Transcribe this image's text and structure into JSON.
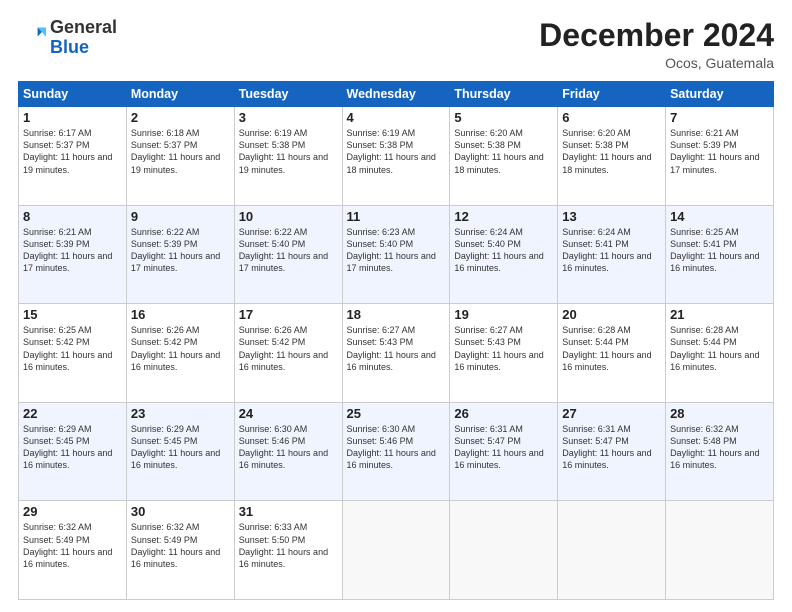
{
  "header": {
    "logo_line1": "General",
    "logo_line2": "Blue",
    "month_title": "December 2024",
    "location": "Ocos, Guatemala"
  },
  "days_of_week": [
    "Sunday",
    "Monday",
    "Tuesday",
    "Wednesday",
    "Thursday",
    "Friday",
    "Saturday"
  ],
  "weeks": [
    [
      {
        "day": "1",
        "sunrise": "6:17 AM",
        "sunset": "5:37 PM",
        "daylight": "11 hours and 19 minutes."
      },
      {
        "day": "2",
        "sunrise": "6:18 AM",
        "sunset": "5:37 PM",
        "daylight": "11 hours and 19 minutes."
      },
      {
        "day": "3",
        "sunrise": "6:19 AM",
        "sunset": "5:38 PM",
        "daylight": "11 hours and 19 minutes."
      },
      {
        "day": "4",
        "sunrise": "6:19 AM",
        "sunset": "5:38 PM",
        "daylight": "11 hours and 18 minutes."
      },
      {
        "day": "5",
        "sunrise": "6:20 AM",
        "sunset": "5:38 PM",
        "daylight": "11 hours and 18 minutes."
      },
      {
        "day": "6",
        "sunrise": "6:20 AM",
        "sunset": "5:38 PM",
        "daylight": "11 hours and 18 minutes."
      },
      {
        "day": "7",
        "sunrise": "6:21 AM",
        "sunset": "5:39 PM",
        "daylight": "11 hours and 17 minutes."
      }
    ],
    [
      {
        "day": "8",
        "sunrise": "6:21 AM",
        "sunset": "5:39 PM",
        "daylight": "11 hours and 17 minutes."
      },
      {
        "day": "9",
        "sunrise": "6:22 AM",
        "sunset": "5:39 PM",
        "daylight": "11 hours and 17 minutes."
      },
      {
        "day": "10",
        "sunrise": "6:22 AM",
        "sunset": "5:40 PM",
        "daylight": "11 hours and 17 minutes."
      },
      {
        "day": "11",
        "sunrise": "6:23 AM",
        "sunset": "5:40 PM",
        "daylight": "11 hours and 17 minutes."
      },
      {
        "day": "12",
        "sunrise": "6:24 AM",
        "sunset": "5:40 PM",
        "daylight": "11 hours and 16 minutes."
      },
      {
        "day": "13",
        "sunrise": "6:24 AM",
        "sunset": "5:41 PM",
        "daylight": "11 hours and 16 minutes."
      },
      {
        "day": "14",
        "sunrise": "6:25 AM",
        "sunset": "5:41 PM",
        "daylight": "11 hours and 16 minutes."
      }
    ],
    [
      {
        "day": "15",
        "sunrise": "6:25 AM",
        "sunset": "5:42 PM",
        "daylight": "11 hours and 16 minutes."
      },
      {
        "day": "16",
        "sunrise": "6:26 AM",
        "sunset": "5:42 PM",
        "daylight": "11 hours and 16 minutes."
      },
      {
        "day": "17",
        "sunrise": "6:26 AM",
        "sunset": "5:42 PM",
        "daylight": "11 hours and 16 minutes."
      },
      {
        "day": "18",
        "sunrise": "6:27 AM",
        "sunset": "5:43 PM",
        "daylight": "11 hours and 16 minutes."
      },
      {
        "day": "19",
        "sunrise": "6:27 AM",
        "sunset": "5:43 PM",
        "daylight": "11 hours and 16 minutes."
      },
      {
        "day": "20",
        "sunrise": "6:28 AM",
        "sunset": "5:44 PM",
        "daylight": "11 hours and 16 minutes."
      },
      {
        "day": "21",
        "sunrise": "6:28 AM",
        "sunset": "5:44 PM",
        "daylight": "11 hours and 16 minutes."
      }
    ],
    [
      {
        "day": "22",
        "sunrise": "6:29 AM",
        "sunset": "5:45 PM",
        "daylight": "11 hours and 16 minutes."
      },
      {
        "day": "23",
        "sunrise": "6:29 AM",
        "sunset": "5:45 PM",
        "daylight": "11 hours and 16 minutes."
      },
      {
        "day": "24",
        "sunrise": "6:30 AM",
        "sunset": "5:46 PM",
        "daylight": "11 hours and 16 minutes."
      },
      {
        "day": "25",
        "sunrise": "6:30 AM",
        "sunset": "5:46 PM",
        "daylight": "11 hours and 16 minutes."
      },
      {
        "day": "26",
        "sunrise": "6:31 AM",
        "sunset": "5:47 PM",
        "daylight": "11 hours and 16 minutes."
      },
      {
        "day": "27",
        "sunrise": "6:31 AM",
        "sunset": "5:47 PM",
        "daylight": "11 hours and 16 minutes."
      },
      {
        "day": "28",
        "sunrise": "6:32 AM",
        "sunset": "5:48 PM",
        "daylight": "11 hours and 16 minutes."
      }
    ],
    [
      {
        "day": "29",
        "sunrise": "6:32 AM",
        "sunset": "5:49 PM",
        "daylight": "11 hours and 16 minutes."
      },
      {
        "day": "30",
        "sunrise": "6:32 AM",
        "sunset": "5:49 PM",
        "daylight": "11 hours and 16 minutes."
      },
      {
        "day": "31",
        "sunrise": "6:33 AM",
        "sunset": "5:50 PM",
        "daylight": "11 hours and 16 minutes."
      },
      null,
      null,
      null,
      null
    ]
  ]
}
